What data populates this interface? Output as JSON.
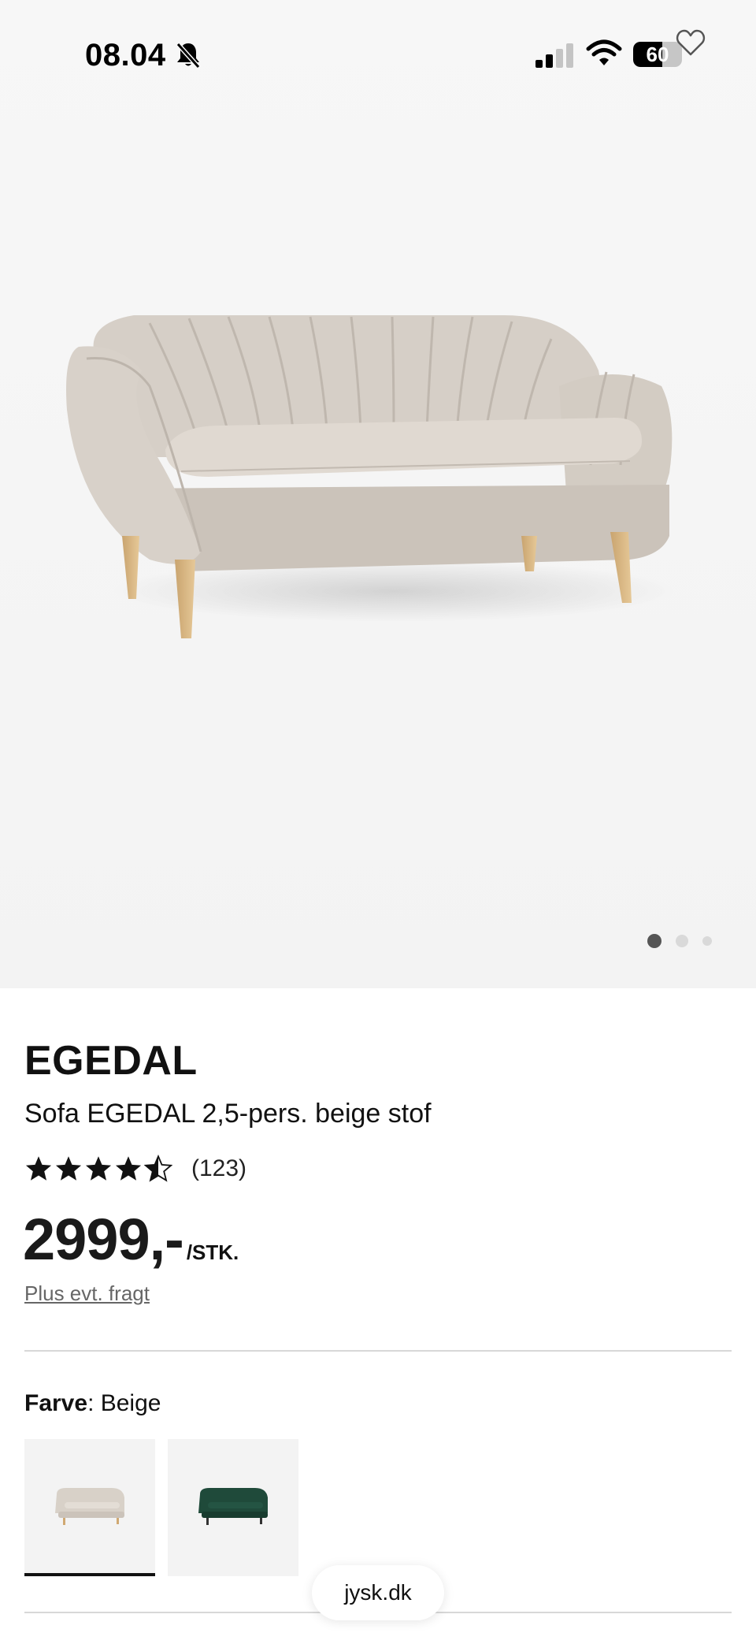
{
  "status_bar": {
    "time": "08.04",
    "battery_level": "60",
    "battery_fraction": 0.6,
    "icons": [
      "bell-slash-icon",
      "signal-icon",
      "wifi-icon",
      "battery-icon",
      "heart-icon"
    ]
  },
  "gallery": {
    "image_count": 3,
    "active_index": 0
  },
  "product": {
    "brand": "EGEDAL",
    "name": "Sofa EGEDAL 2,5-pers. beige stof",
    "rating": 4.5,
    "rating_max": 5,
    "review_count": "(123)",
    "price": "2999,-",
    "unit": "/STK.",
    "shipping_note": "Plus evt. fragt"
  },
  "color": {
    "label": "Farve",
    "value": ": Beige",
    "swatches": [
      {
        "name": "Beige",
        "color": "#d8d1c8",
        "selected": true
      },
      {
        "name": "Grøn",
        "color": "#1f4a3a",
        "selected": false
      }
    ]
  },
  "browser": {
    "url": "jysk.dk"
  }
}
